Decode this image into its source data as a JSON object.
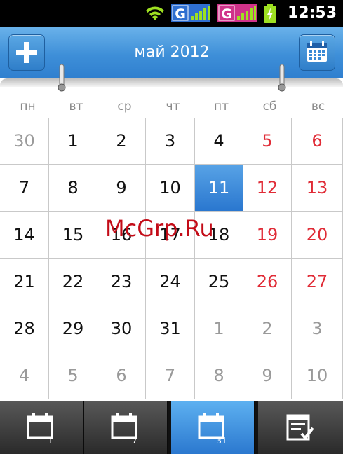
{
  "status_bar": {
    "time": "12:53",
    "sim1_label": "G",
    "sim2_label": "G",
    "icons": [
      "wifi-icon",
      "sim1-signal-icon",
      "sim2-signal-icon",
      "battery-charging-icon"
    ]
  },
  "header": {
    "title": "май 2012",
    "add_icon": "plus-icon",
    "calendar_icon": "calendar-icon"
  },
  "weekdays": [
    "пн",
    "вт",
    "ср",
    "чт",
    "пт",
    "сб",
    "вс"
  ],
  "weeks": [
    [
      "30",
      "1",
      "2",
      "3",
      "4",
      "5",
      "6"
    ],
    [
      "7",
      "8",
      "9",
      "10",
      "11",
      "12",
      "13"
    ],
    [
      "14",
      "15",
      "16",
      "17",
      "18",
      "19",
      "20"
    ],
    [
      "21",
      "22",
      "23",
      "24",
      "25",
      "26",
      "27"
    ],
    [
      "28",
      "29",
      "30",
      "31",
      "1",
      "2",
      "3"
    ],
    [
      "4",
      "5",
      "6",
      "7",
      "8",
      "9",
      "10"
    ]
  ],
  "selected_day": "11",
  "watermark": "McGrp.Ru",
  "tabs": {
    "day_badge": "1",
    "week_badge": "7",
    "month_badge": "31",
    "active": "month",
    "icons": [
      "calendar-day-icon",
      "calendar-week-icon",
      "calendar-month-icon",
      "task-list-icon"
    ]
  },
  "colors": {
    "accent": "#3a8ad6",
    "weekend": "#e02b36",
    "other_month": "#9a9a9a"
  }
}
